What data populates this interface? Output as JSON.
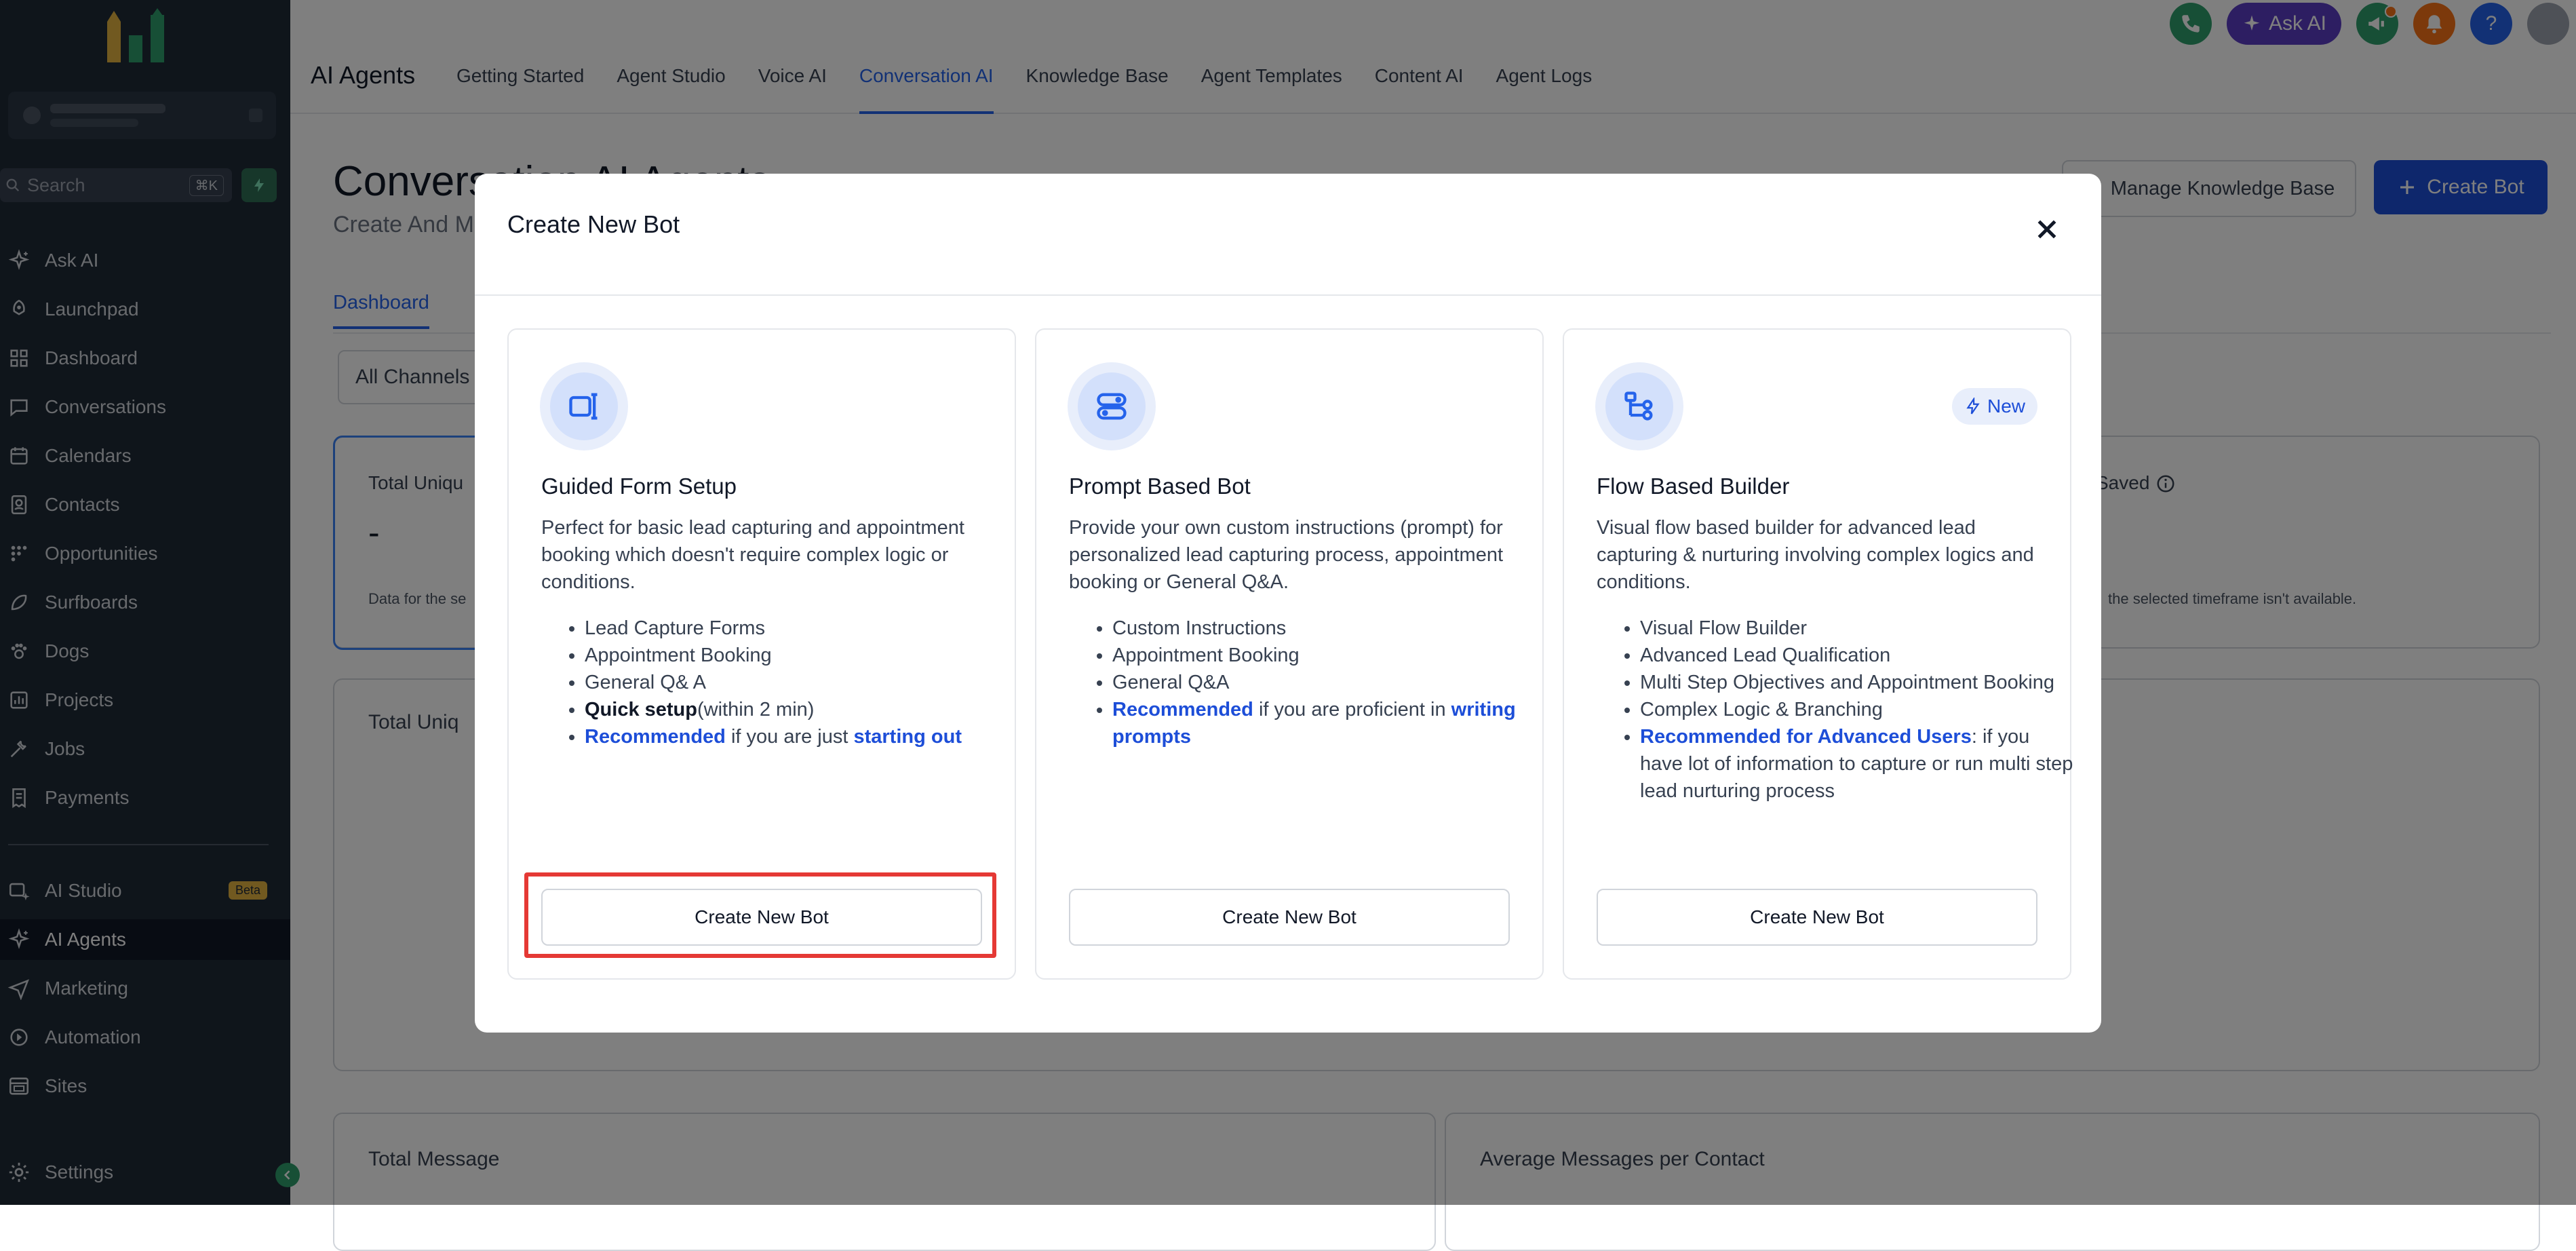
{
  "sidebar": {
    "search": {
      "placeholder": "Search",
      "shortcut": "⌘K"
    },
    "items": [
      {
        "label": "Ask AI",
        "icon": "sparkle-icon"
      },
      {
        "label": "Launchpad",
        "icon": "rocket-icon"
      },
      {
        "label": "Dashboard",
        "icon": "grid-icon"
      },
      {
        "label": "Conversations",
        "icon": "chat-icon"
      },
      {
        "label": "Calendars",
        "icon": "calendar-icon"
      },
      {
        "label": "Contacts",
        "icon": "contacts-icon"
      },
      {
        "label": "Opportunities",
        "icon": "funnel-icon"
      },
      {
        "label": "Surfboards",
        "icon": "surfboard-icon"
      },
      {
        "label": "Dogs",
        "icon": "paw-icon"
      },
      {
        "label": "Projects",
        "icon": "chart-icon"
      },
      {
        "label": "Jobs",
        "icon": "tools-icon"
      },
      {
        "label": "Payments",
        "icon": "receipt-icon"
      }
    ],
    "items2": [
      {
        "label": "AI Studio",
        "icon": "ai-studio-icon",
        "badge": "Beta"
      },
      {
        "label": "AI Agents",
        "icon": "sparkle-icon"
      },
      {
        "label": "Marketing",
        "icon": "send-icon"
      },
      {
        "label": "Automation",
        "icon": "automation-icon"
      },
      {
        "label": "Sites",
        "icon": "sites-icon"
      }
    ],
    "settings": {
      "label": "Settings",
      "icon": "gear-icon"
    }
  },
  "header": {
    "brand": "AI Agents",
    "tabs": [
      "Getting Started",
      "Agent Studio",
      "Voice AI",
      "Conversation AI",
      "Knowledge Base",
      "Agent Templates",
      "Content AI",
      "Agent Logs"
    ],
    "active_tab": "Conversation AI",
    "ask_ai_label": "Ask AI",
    "help_label": "?"
  },
  "page": {
    "title": "Conversation AI Agents",
    "subtitle": "Create And M",
    "manage_kb_label": "Manage Knowledge Base",
    "create_bot_label": "Create Bot",
    "subtab": "Dashboard",
    "filter_value": "All Channels",
    "metric1_label": "Total Uniqu",
    "metric1_value": "-",
    "metric1_note": "Data for the se",
    "metric2_label": "Saved",
    "metric2_note": "the selected timeframe isn't available.",
    "card_b_title": "Total Uniq",
    "card_c_title": "Total Message",
    "card_d_title": "Average Messages per Contact"
  },
  "modal": {
    "title": "Create New Bot",
    "options": [
      {
        "title": "Guided Form Setup",
        "icon": "form-icon",
        "description": "Perfect for basic lead capturing and appointment booking which doesn't require complex logic or conditions.",
        "bullets": [
          "Lead Capture Forms",
          "Appointment Booking",
          "General Q& A"
        ],
        "quick_bold": "Quick setup",
        "quick_rest": "(within 2 min)",
        "rec_bold": "Recommended",
        "rec_mid": " if you are just ",
        "rec_bold2": "starting out",
        "button": "Create New Bot"
      },
      {
        "title": "Prompt Based Bot",
        "icon": "toggles-icon",
        "description": "Provide your own custom instructions (prompt) for personalized lead capturing process, appointment booking or General Q&A.",
        "bullets": [
          "Custom Instructions",
          "Appointment Booking",
          "General Q&A"
        ],
        "rec_bold": "Recommended",
        "rec_mid": " if you are proficient in ",
        "rec_bold2": "writing prompts",
        "button": "Create New Bot"
      },
      {
        "title": "Flow Based Builder",
        "icon": "flow-icon",
        "badge": "New",
        "description": "Visual flow based builder for advanced lead capturing & nurturing involving complex logics and conditions.",
        "bullets": [
          "Visual Flow Builder",
          "Advanced Lead Qualification",
          "Multi Step Objectives and Appointment Booking",
          "Complex Logic & Branching"
        ],
        "rec_bold": "Recommended for Advanced Users",
        "rec_mid": ": if you have lot of information to capture or run multi step lead nurturing process",
        "button": "Create New Bot"
      }
    ]
  },
  "colors": {
    "sidebar_bg": "#1f2a37",
    "accent": "#1d4ed8",
    "highlight": "#e53935",
    "ask_ai": "#5b3cc4"
  }
}
